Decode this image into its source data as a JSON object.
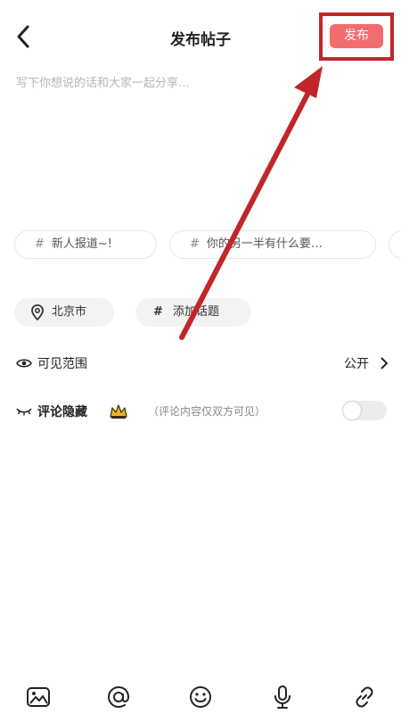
{
  "header": {
    "title": "发布帖子",
    "publish_label": "发布"
  },
  "post": {
    "placeholder": "写下你想说的话和大家一起分享…"
  },
  "suggested_topics": [
    {
      "label": "新人报道~!"
    },
    {
      "label": "你的另一半有什么要…"
    }
  ],
  "chips": {
    "location": "北京市",
    "add_topic": "添加话题"
  },
  "visibility": {
    "label": "可见范围",
    "value": "公开"
  },
  "comment_hide": {
    "label": "评论隐藏",
    "hint": "（评论内容仅双方可见）",
    "enabled": false
  },
  "toolbar": {
    "icons": [
      "image-icon",
      "at-icon",
      "emoji-icon",
      "microphone-icon",
      "link-icon"
    ]
  },
  "colors": {
    "publish_button": "#f26d6d",
    "annotation": "#c0262a",
    "premium_gold": "#d8a81c"
  }
}
